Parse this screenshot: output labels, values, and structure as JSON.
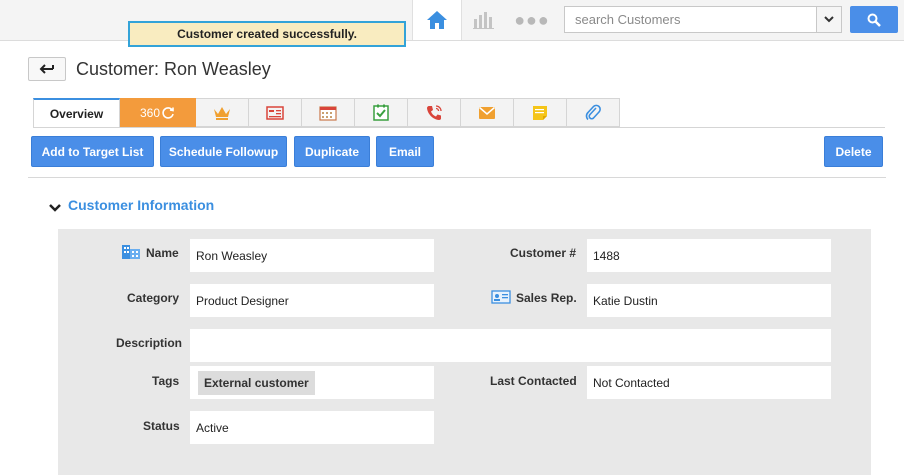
{
  "toast": {
    "message": "Customer created successfully."
  },
  "header": {
    "search_placeholder": "search Customers",
    "more_glyph": "●●●"
  },
  "title": {
    "text": "Customer: Ron Weasley"
  },
  "tabs": [
    {
      "label": "Overview"
    },
    {
      "label": "360"
    }
  ],
  "actions": {
    "add_to_target": "Add to Target List",
    "schedule_followup": "Schedule Followup",
    "duplicate": "Duplicate",
    "email": "Email",
    "delete": "Delete"
  },
  "section": {
    "title": "Customer Information"
  },
  "fields": {
    "name": {
      "label": "Name",
      "value": "Ron Weasley"
    },
    "customer_no": {
      "label": "Customer #",
      "value": "1488"
    },
    "category": {
      "label": "Category",
      "value": "Product Designer"
    },
    "sales_rep": {
      "label": "Sales Rep.",
      "value": "Katie Dustin"
    },
    "description": {
      "label": "Description",
      "value": ""
    },
    "tags": {
      "label": "Tags",
      "value": "External customer"
    },
    "last_contacted": {
      "label": "Last Contacted",
      "value": "Not Contacted"
    },
    "status": {
      "label": "Status",
      "value": "Active"
    }
  },
  "colors": {
    "accent": "#4a8ee8",
    "tab_360": "#f39b3c",
    "toast_bg": "#f9ecc0",
    "toast_border": "#33a3d8"
  }
}
